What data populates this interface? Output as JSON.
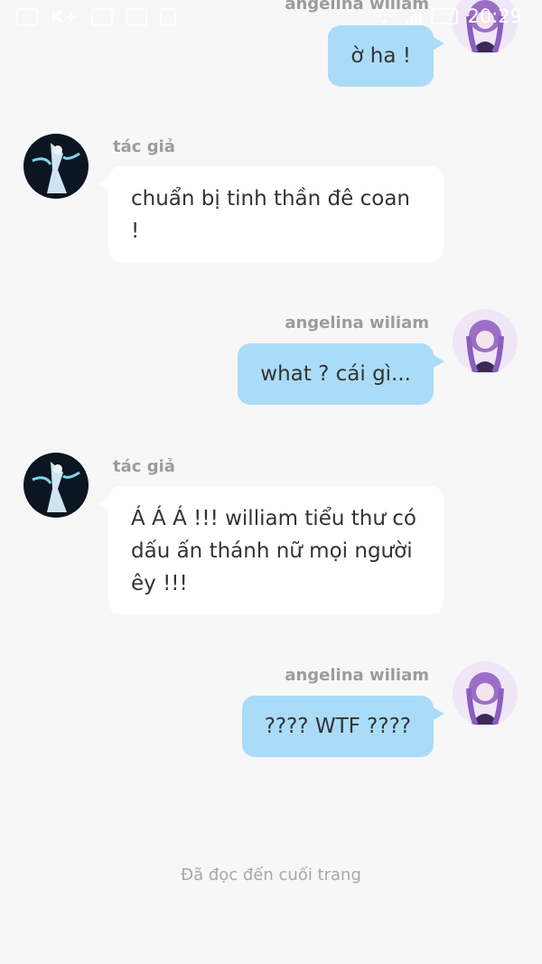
{
  "status_bar": {
    "carrier_badge": "K+",
    "time": "20:29"
  },
  "messages": [
    {
      "side": "right",
      "author": "angelina wiliam",
      "text": "ờ ha !"
    },
    {
      "side": "left",
      "author": "tác giả",
      "text": "chuẩn bị tinh thần đê coan !"
    },
    {
      "side": "right",
      "author": "angelina wiliam",
      "text": "what ? cái gì..."
    },
    {
      "side": "left",
      "author": "tác giả",
      "text": "Á Á Á !!! william tiểu thư có dấu ấn thánh nữ mọi người êy !!!"
    },
    {
      "side": "right",
      "author": "angelina wiliam",
      "text": "???? WTF ????"
    }
  ],
  "footer": {
    "end_text": "Đã đọc đến cuối trang"
  },
  "colors": {
    "background": "#f7f7f7",
    "outgoing_bubble": "#aadcf7",
    "incoming_bubble": "#ffffff",
    "name_text": "#9c9c9c"
  },
  "icons": {
    "incoming_avatar": "avatar-dark-blue-figure",
    "outgoing_avatar": "avatar-purple-hair-girl"
  }
}
